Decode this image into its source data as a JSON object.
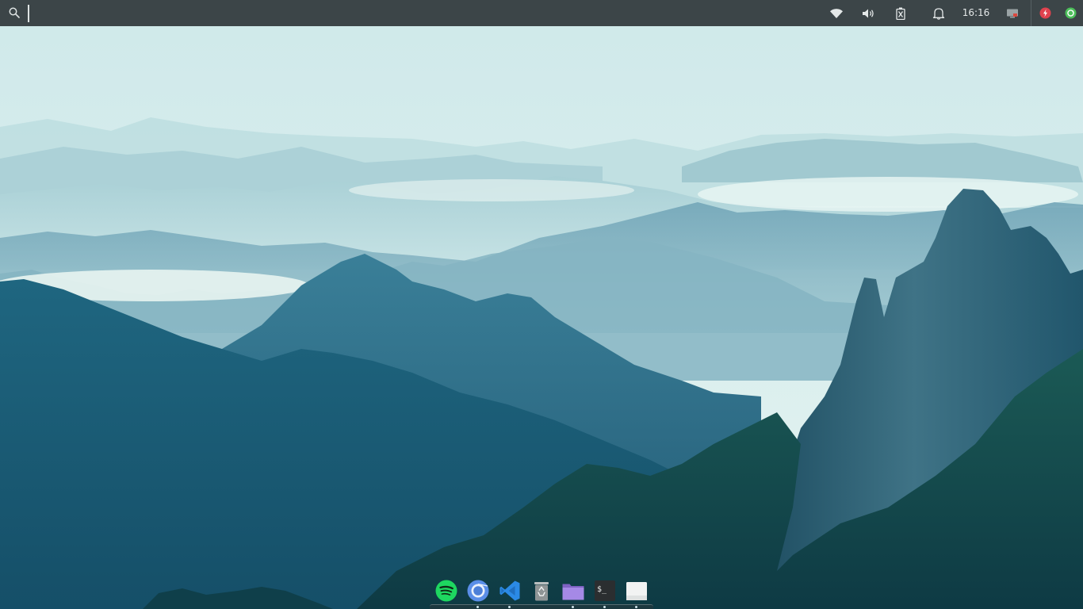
{
  "top_panel": {
    "search_icon": "search-icon",
    "tray_icons": [
      "wifi-icon",
      "volume-icon",
      "battery-icon",
      "notifications-icon"
    ],
    "clock": "16:16",
    "status_icons": [
      "display-icon",
      "power-indicator-icon",
      "sync-indicator-icon"
    ]
  },
  "dock": {
    "apps": [
      {
        "name": "spotify",
        "icon": "spotify-icon",
        "color": "#1ed760"
      },
      {
        "name": "chromium",
        "icon": "chromium-icon",
        "color": "#5a8ee8"
      },
      {
        "name": "visual-studio-code",
        "icon": "vscode-icon",
        "color": "#2b8ae6"
      },
      {
        "name": "trash",
        "icon": "trash-icon",
        "color": "#8f9596"
      },
      {
        "name": "files",
        "icon": "folder-icon",
        "color": "#9f7ee0"
      },
      {
        "name": "terminal",
        "icon": "terminal-icon",
        "color": "#2b2e30"
      },
      {
        "name": "text-editor",
        "icon": "document-icon",
        "color": "#f2f3f3"
      }
    ]
  },
  "colors": {
    "panel": "#3c4548",
    "power_indicator": "#e0424e",
    "sync_indicator": "#4cbf5a"
  }
}
